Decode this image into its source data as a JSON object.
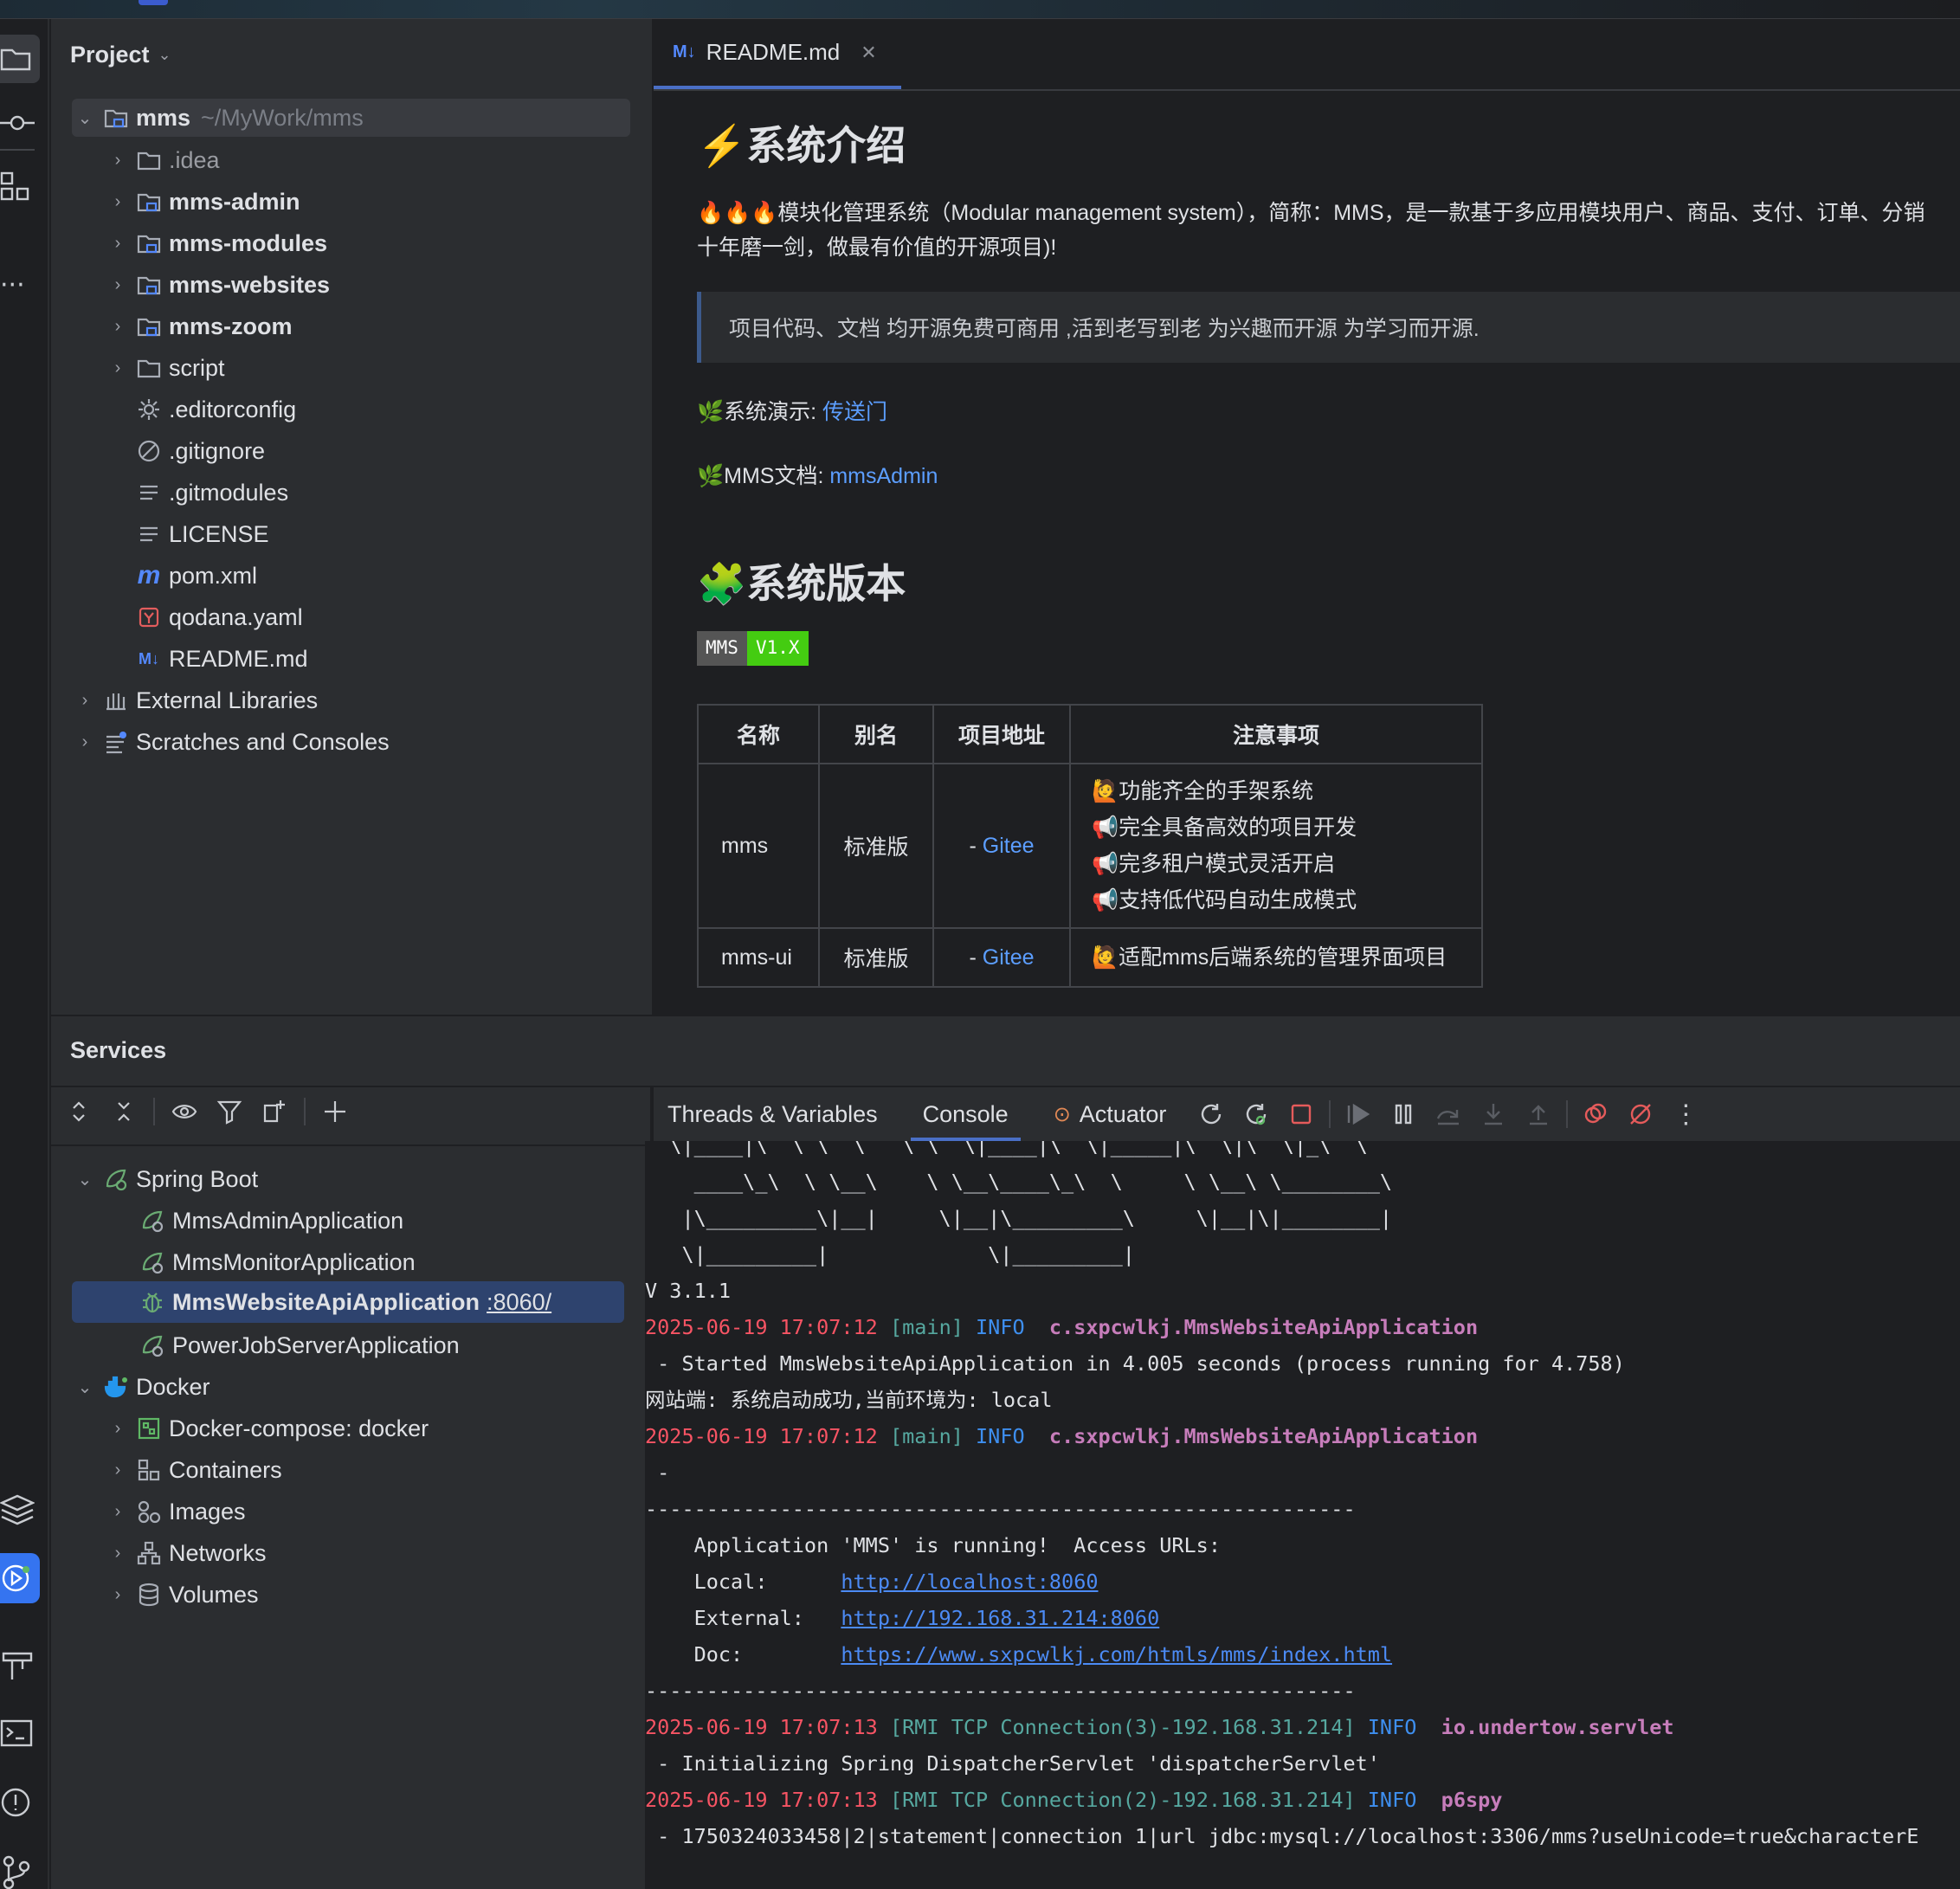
{
  "project_panel": {
    "title": "Project",
    "tree": [
      {
        "label": "mms",
        "hint": "~/MyWork/mms",
        "icon": "module-folder-icon"
      },
      {
        "label": ".idea",
        "icon": "folder-icon"
      },
      {
        "label": "mms-admin",
        "icon": "module-folder-icon"
      },
      {
        "label": "mms-modules",
        "icon": "module-folder-icon"
      },
      {
        "label": "mms-websites",
        "icon": "module-folder-icon"
      },
      {
        "label": "mms-zoom",
        "icon": "module-folder-icon"
      },
      {
        "label": "script",
        "icon": "folder-icon"
      },
      {
        "label": ".editorconfig",
        "icon": "gear-icon"
      },
      {
        "label": ".gitignore",
        "icon": "ignore-icon"
      },
      {
        "label": ".gitmodules",
        "icon": "text-file-icon"
      },
      {
        "label": "LICENSE",
        "icon": "text-file-icon"
      },
      {
        "label": "pom.xml",
        "icon": "maven-icon"
      },
      {
        "label": "qodana.yaml",
        "icon": "yaml-icon"
      },
      {
        "label": "README.md",
        "icon": "markdown-icon"
      },
      {
        "label": "External Libraries",
        "icon": "library-icon"
      },
      {
        "label": "Scratches and Consoles",
        "icon": "scratches-icon"
      }
    ]
  },
  "editor": {
    "tab_label": "README.md",
    "tab_icon": "M↓",
    "h_intro": "⚡系统介绍",
    "intro_line1": "🔥🔥🔥模块化管理系统（Modular management system），简称：MMS，是一款基于多应用模块用户、商品、支付、订单、分销",
    "intro_line2": "十年磨一剑，做最有价值的开源项目)!",
    "quote": "项目代码、文档 均开源免费可商用 ,活到老写到老 为兴趣而开源 为学习而开源.",
    "demo_label": "🌿系统演示: ",
    "demo_link": "传送门",
    "doc_label": "🌿MMS文档: ",
    "doc_link": "mmsAdmin",
    "h_version": "🧩系统版本",
    "badge_left": "MMS",
    "badge_right": "V1.X",
    "table": {
      "headers": [
        "名称",
        "别名",
        "项目地址",
        "注意事项"
      ],
      "rows": [
        {
          "name": "mms",
          "alias": "标准版",
          "addr_prefix": "- ",
          "addr_link": "Gitee",
          "notes": [
            "🙋功能齐全的手架系统",
            "📢完全具备高效的项目开发",
            "📢完多租户模式灵活开启",
            "📢支持低代码自动生成模式"
          ]
        },
        {
          "name": "mms-ui",
          "alias": "标准版",
          "addr_prefix": "- ",
          "addr_link": "Gitee",
          "notes": [
            "🙋适配mms后端系统的管理界面项目"
          ]
        }
      ]
    }
  },
  "services": {
    "title": "Services",
    "tree": {
      "spring_boot": "Spring Boot",
      "apps": [
        "MmsAdminApplication",
        "MmsMonitorApplication",
        "MmsWebsiteApiApplication",
        "PowerJobServerApplication"
      ],
      "running_port": ":8060/",
      "docker": "Docker",
      "docker_items": [
        "Docker-compose: docker",
        "Containers",
        "Images",
        "Networks",
        "Volumes"
      ]
    },
    "console_tabs": [
      "Threads & Variables",
      "Console",
      "Actuator"
    ],
    "console": {
      "banner": [
        "  \\|____|\\  \\ \\  \\   \\ \\  \\|____|\\  \\|_____|\\  \\|\\  \\|_\\  \\",
        "    ____\\_\\  \\ \\__\\    \\ \\__\\____\\_\\  \\     \\ \\__\\ \\________\\",
        "   |\\_________\\|__|     \\|__|\\_________\\     \\|__|\\|________|",
        "   \\|_________|             \\|_________|"
      ],
      "version": "V 3.1.1",
      "log1": {
        "ts": "2025-06-19 17:07:12",
        "thread": "[main]",
        "level": "INFO",
        "cls": "c.sxpcwlkj.MmsWebsiteApiApplication"
      },
      "log1_msg": " - Started MmsWebsiteApiApplication in 4.005 seconds (process running for 4.758)",
      "log1_msg2": "网站端: 系统启动成功,当前环境为: local",
      "log2": {
        "ts": "2025-06-19 17:07:12",
        "thread": "[main]",
        "level": "INFO",
        "cls": "c.sxpcwlkj.MmsWebsiteApiApplication"
      },
      "log2_msg": " -",
      "dashes": "----------------------------------------------------------",
      "app_running": "    Application 'MMS' is running!  Access URLs:",
      "local_label": "    Local:      ",
      "local_url": "http://localhost:8060",
      "external_label": "    External:   ",
      "external_url": "http://192.168.31.214:8060",
      "doc_label": "    Doc:        ",
      "doc_url": "https://www.sxpcwlkj.com/htmls/mms/index.html",
      "log3": {
        "ts": "2025-06-19 17:07:13",
        "thread": "[RMI TCP Connection(3)-192.168.31.214]",
        "level": "INFO",
        "cls": "io.undertow.servlet"
      },
      "log3_msg": " - Initializing Spring DispatcherServlet 'dispatcherServlet'",
      "log4": {
        "ts": "2025-06-19 17:07:13",
        "thread": "[RMI TCP Connection(2)-192.168.31.214]",
        "level": "INFO",
        "cls": "p6spy"
      },
      "log4_msg": " - 1750324033458|2|statement|connection 1|url jdbc:mysql://localhost:3306/mms?useUnicode=true&characterE"
    }
  },
  "colors": {
    "accent": "#4a6fc6",
    "link": "#5c9eff",
    "timestamp": "#f75464",
    "thread": "#56a8a0",
    "info": "#3e8ff0",
    "logger": "#c77dbb"
  }
}
